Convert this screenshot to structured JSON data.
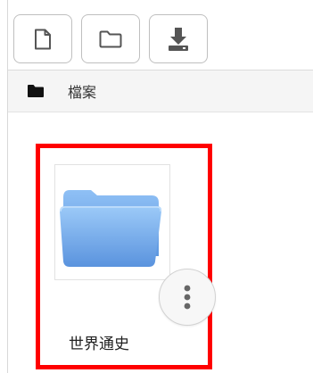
{
  "toolbar": {
    "buttons": [
      {
        "icon": "new-file-icon"
      },
      {
        "icon": "new-folder-icon"
      },
      {
        "icon": "download-icon"
      }
    ]
  },
  "breadcrumb": {
    "icon": "folder-icon",
    "label": "檔案"
  },
  "folder": {
    "name": "世界通史",
    "icon": "folder-icon",
    "menu_icon": "more-vertical-icon"
  },
  "colors": {
    "highlight_border": "#ff0000",
    "folder_blue": "#6aa6ec",
    "toolbar_icon": "#555555"
  }
}
